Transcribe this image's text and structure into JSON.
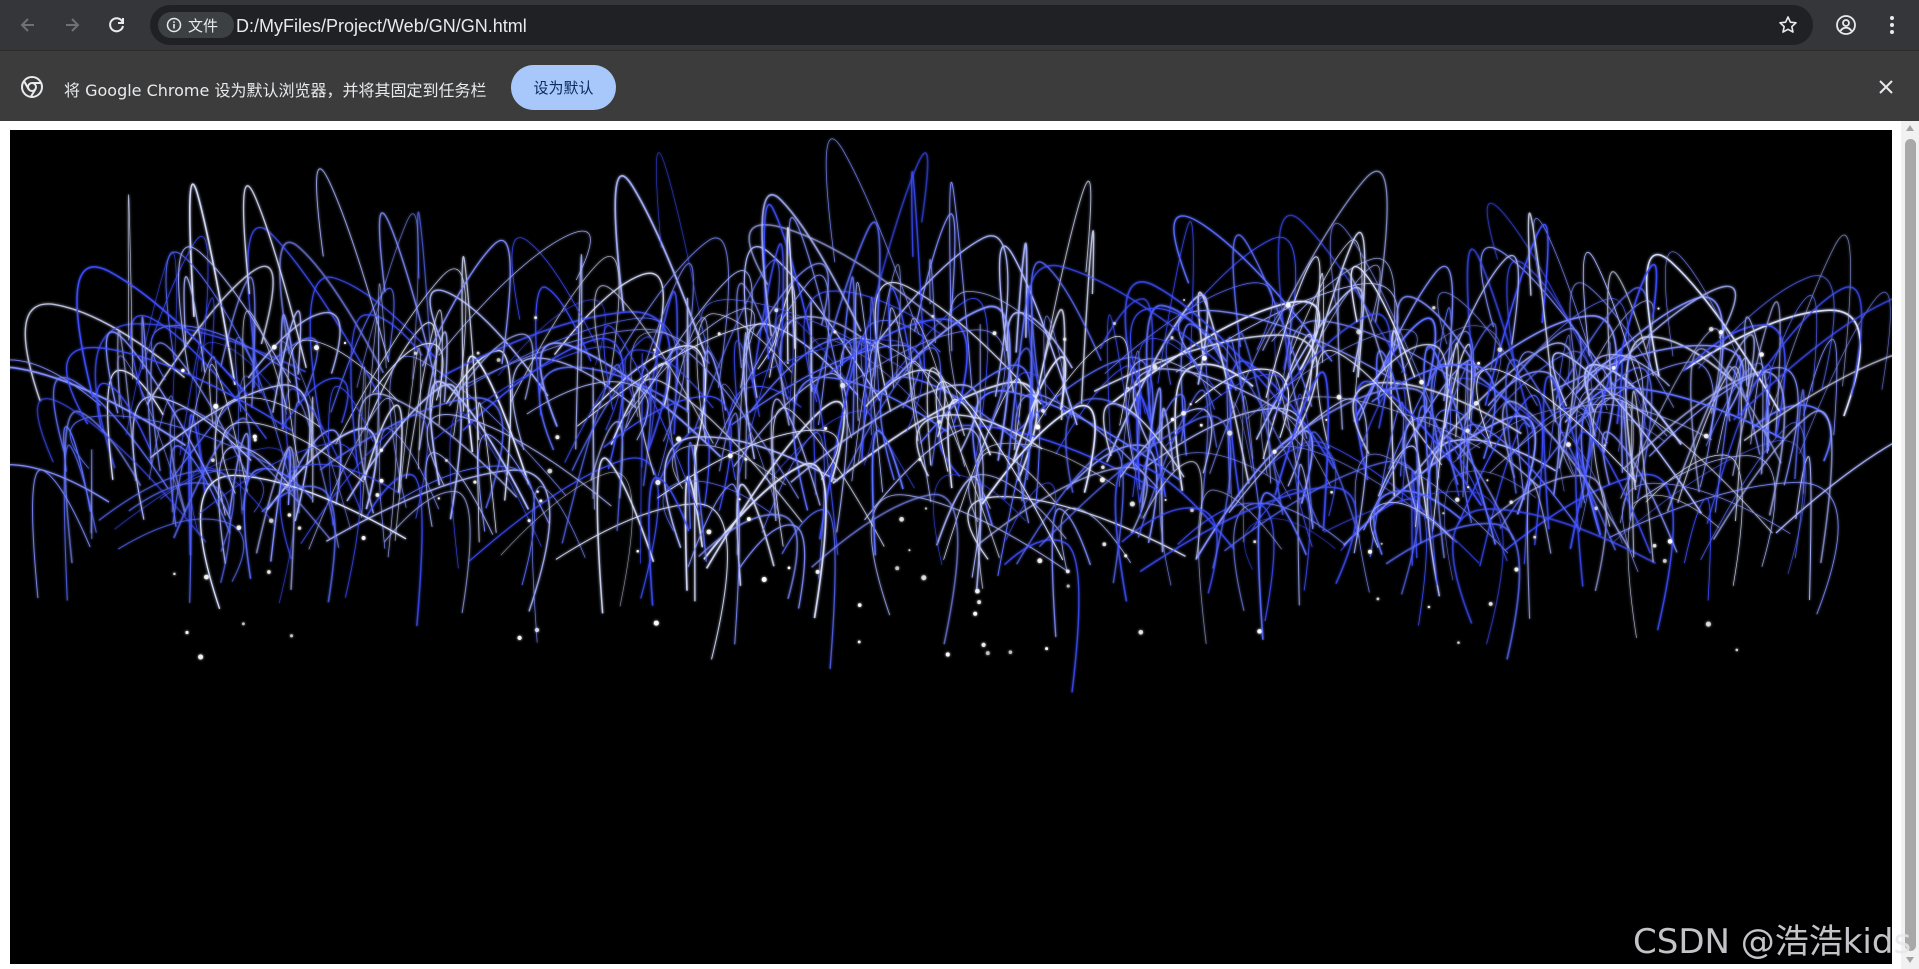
{
  "toolbar": {
    "back_icon": "arrow-left-icon",
    "forward_icon": "arrow-right-icon",
    "reload_icon": "reload-icon",
    "site_info_label": "文件",
    "url": "D:/MyFiles/Project/Web/GN/GN.html",
    "bookmark_icon": "star-icon",
    "profile_icon": "account-icon",
    "menu_icon": "kebab-menu-icon"
  },
  "infobar": {
    "icon": "chrome-icon",
    "message": "将 Google Chrome 设为默认浏览器，并将其固定到任务栏",
    "action_label": "设为默认",
    "close_icon": "close-icon"
  },
  "page": {
    "description_color_bg": "#000000",
    "firework_color": "#5a6cff"
  },
  "watermark": {
    "text": "CSDN @浩浩kids"
  },
  "colors": {
    "toolbar_bg": "#35363a",
    "infobar_bg": "#3c3c3c",
    "accent_button": "#a8c7fa"
  }
}
